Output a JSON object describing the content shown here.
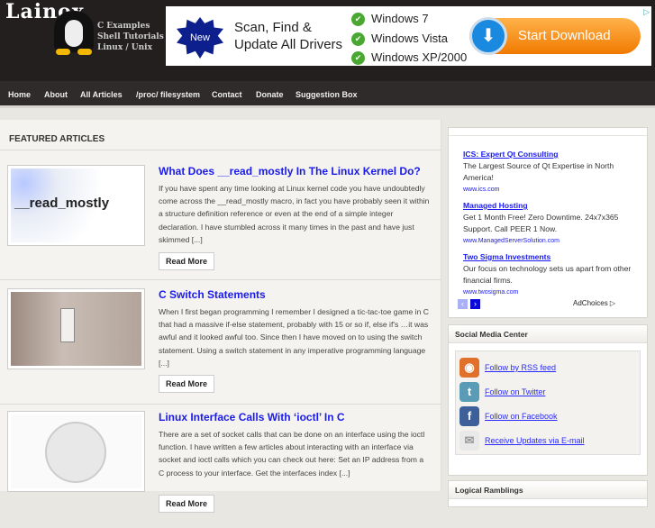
{
  "site": {
    "logo": "Lainox",
    "tagline": [
      "C Examples",
      "Shell Tutorials",
      "Linux / Unix"
    ]
  },
  "banner": {
    "badge": "New",
    "headline": [
      "Scan, Find &",
      "Update All Drivers"
    ],
    "list": [
      "Windows 7",
      "Windows Vista",
      "Windows XP/2000"
    ],
    "button": "Start Download"
  },
  "nav": [
    "Home",
    "About",
    "All Articles",
    "/proc/ filesystem",
    "Contact",
    "Donate",
    "Suggestion Box"
  ],
  "main": {
    "heading": "FEATURED ARTICLES",
    "articles": [
      {
        "title": "What Does __read_mostly In The Linux Kernel Do?",
        "thumb_text": "__read_mostly",
        "excerpt": "If you have spent any time looking at Linux kernel code you have undoubtedly come across the __read_mostly macro, in fact you have probably seen it within a structure definition reference or even at the end of a simple integer declaration. I have stumbled across it many times in the past and have just skimmed [...]",
        "button": "Read More"
      },
      {
        "title": "C Switch Statements",
        "excerpt": "When I first began programming I remember I designed a tic-tac-toe game in C that had a massive if-else statement, probably with 15 or so if, else if's …it was awful and it looked awful too. Since then I have moved on to using the switch statement. Using a switch statement in any imperative programming language [...]",
        "button": "Read More"
      },
      {
        "title": "Linux Interface Calls With ‘ioctl’ In C",
        "excerpt": "There are a set of socket calls that can be done on an interface using the ioctl function. I have written a few articles about interacting with an interface via socket and ioctl calls which you can check out here: Set an IP address from a C process to your interface. Get the interfaces index [...]",
        "button": "Read More"
      }
    ]
  },
  "sidebar": {
    "ads": [
      {
        "title": "ICS: Expert Qt Consulting",
        "text": "The Largest Source of Qt Expertise in North America!",
        "url": "www.ics.com"
      },
      {
        "title": "Managed Hosting",
        "text": "Get 1 Month Free! Zero Downtime. 24x7x365 Support. Call PEER 1 Now.",
        "url": "www.ManagedServerSolution.com"
      },
      {
        "title": "Two Sigma Investments",
        "text": "Our focus on technology sets us apart from other financial firms.",
        "url": "www.twosigma.com"
      }
    ],
    "adchoices": "AdChoices",
    "social_title": "Social Media Center",
    "social": [
      "Follow by RSS feed",
      "Follow on Twitter",
      "Follow on Facebook",
      "Receive Updates via E-mail"
    ],
    "next_title": "Logical Ramblings"
  }
}
